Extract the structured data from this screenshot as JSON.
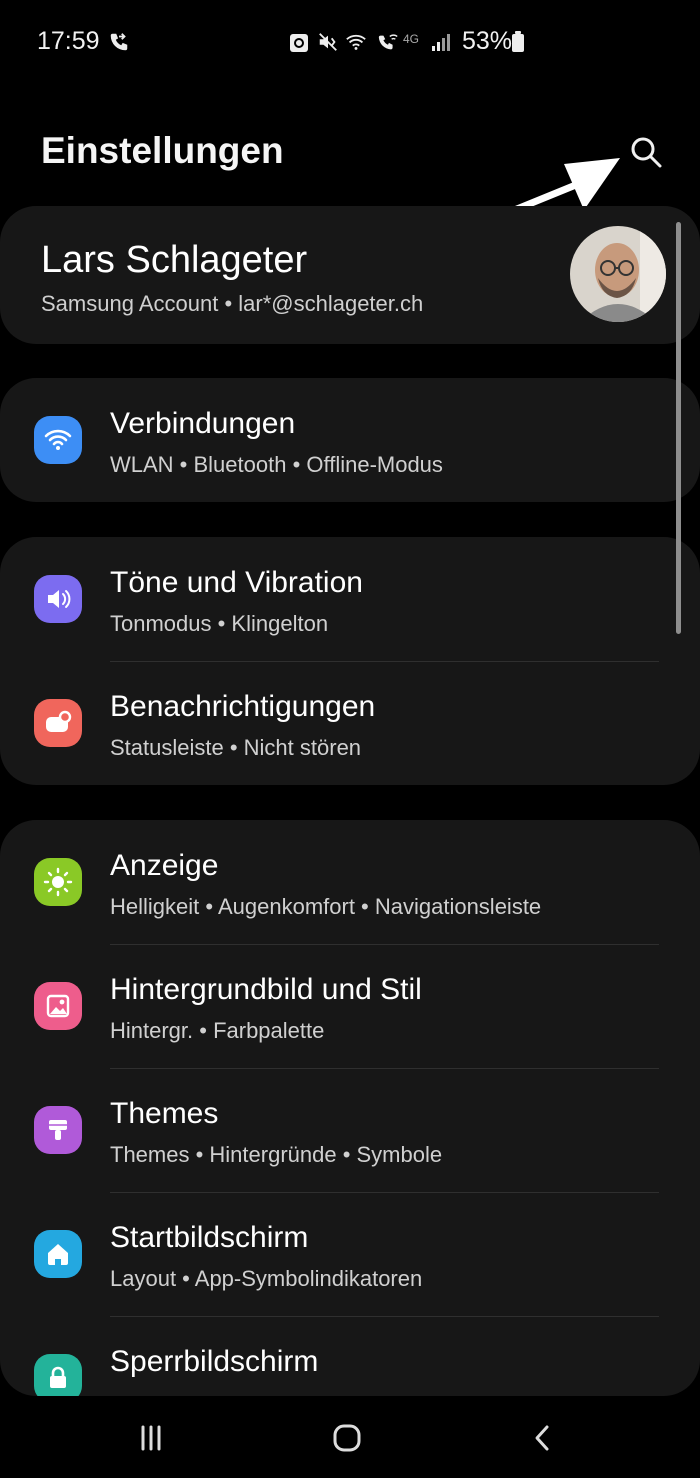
{
  "status_bar": {
    "time": "17:59",
    "network": "4G",
    "battery": "53%",
    "icons": [
      "wifi-calling-icon",
      "recycle-icon",
      "mute-vibrate-icon",
      "wifi-icon",
      "wifi-calling-icon",
      "signal-icon",
      "battery-icon"
    ]
  },
  "header": {
    "title": "Einstellungen",
    "search_icon": "search-icon"
  },
  "account": {
    "name": "Lars Schlageter",
    "subtitle": "Samsung Account  •  lar*@schlageter.ch"
  },
  "groups": [
    {
      "items": [
        {
          "label": "Verbindungen",
          "sub": "WLAN  •  Bluetooth  •  Offline-Modus",
          "icon": "wifi-icon",
          "color": "#3d8ef5"
        }
      ]
    },
    {
      "items": [
        {
          "label": "Töne und Vibration",
          "sub": "Tonmodus  •  Klingelton",
          "icon": "volume-icon",
          "color": "#7c6cf0"
        },
        {
          "label": "Benachrichtigungen",
          "sub": "Statusleiste  •  Nicht stören",
          "icon": "notification-icon",
          "color": "#f0665c"
        }
      ]
    },
    {
      "items": [
        {
          "label": "Anzeige",
          "sub": "Helligkeit  •  Augenkomfort  •  Navigationsleiste",
          "icon": "brightness-icon",
          "color": "#8ac926"
        },
        {
          "label": "Hintergrundbild und Stil",
          "sub": "Hintergr.  •  Farbpalette",
          "icon": "wallpaper-icon",
          "color": "#ee5d8c"
        },
        {
          "label": "Themes",
          "sub": "Themes  •  Hintergründe  •  Symbole",
          "icon": "paintbrush-icon",
          "color": "#b05ad9"
        },
        {
          "label": "Startbildschirm",
          "sub": "Layout  •  App-Symbolindikatoren",
          "icon": "home-icon",
          "color": "#24a8e0"
        },
        {
          "label": "Sperrbildschirm",
          "sub": "",
          "icon": "lock-icon",
          "color": "#23b39a"
        }
      ]
    }
  ],
  "nav_bar": [
    "recent-apps-icon",
    "home-button-icon",
    "back-icon"
  ]
}
